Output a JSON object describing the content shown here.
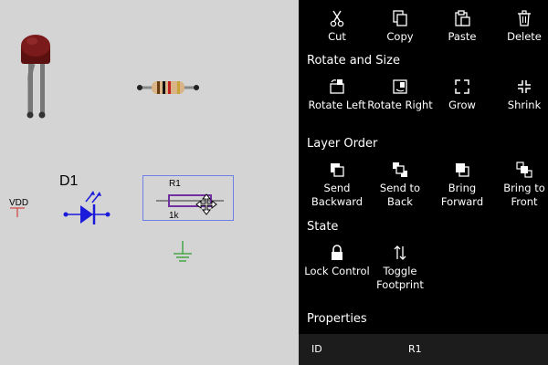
{
  "canvas": {
    "vdd_label": "VDD",
    "led_label": "D1",
    "resistor_ref": "R1",
    "resistor_value": "1k"
  },
  "panel": {
    "clipboard": [
      {
        "label": "Cut",
        "icon": "scissors-icon"
      },
      {
        "label": "Copy",
        "icon": "copy-icon"
      },
      {
        "label": "Paste",
        "icon": "paste-icon"
      },
      {
        "label": "Delete",
        "icon": "trash-icon"
      }
    ],
    "rotate_size": {
      "title": "Rotate and Size",
      "items": [
        {
          "label": "Rotate Left",
          "icon": "rotate-left-icon"
        },
        {
          "label": "Rotate Right",
          "icon": "rotate-right-icon"
        },
        {
          "label": "Grow",
          "icon": "grow-icon"
        },
        {
          "label": "Shrink",
          "icon": "shrink-icon"
        }
      ]
    },
    "layer_order": {
      "title": "Layer Order",
      "items": [
        {
          "label": "Send Backward",
          "icon": "send-backward-icon"
        },
        {
          "label": "Send to Back",
          "icon": "send-to-back-icon"
        },
        {
          "label": "Bring Forward",
          "icon": "bring-forward-icon"
        },
        {
          "label": "Bring to Front",
          "icon": "bring-to-front-icon"
        }
      ]
    },
    "state": {
      "title": "State",
      "items": [
        {
          "label": "Lock Control",
          "icon": "lock-icon"
        },
        {
          "label": "Toggle Footprint",
          "icon": "toggle-arrows-icon"
        }
      ]
    },
    "properties": {
      "title": "Properties",
      "rows": [
        {
          "key": "ID",
          "value": "R1"
        }
      ]
    }
  },
  "colors": {
    "canvas_bg": "#d4d4d4",
    "panel_bg": "#000000",
    "schematic_blue": "#1a1adb",
    "selection_blue": "#6f7fe8",
    "resistor_outline": "#7030a0",
    "ground_green": "#2e9e2e",
    "led_red": "#7a1a1a"
  }
}
